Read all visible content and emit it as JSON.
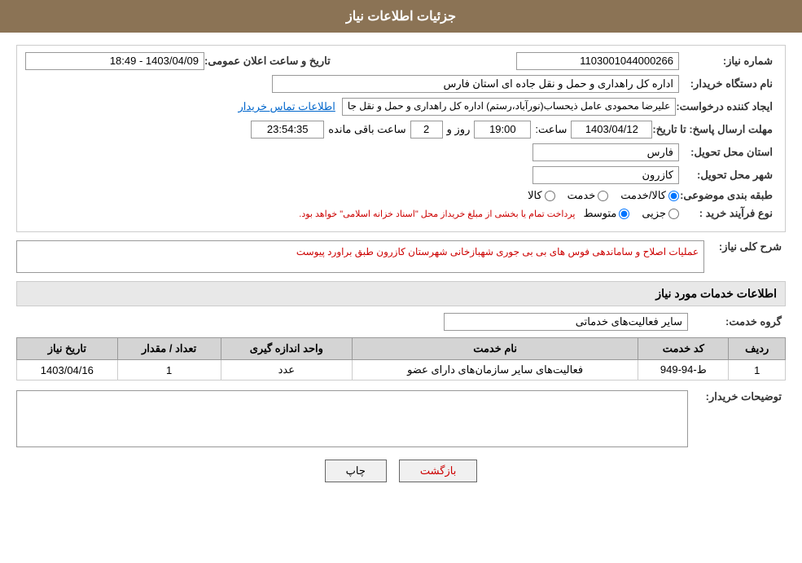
{
  "header": {
    "title": "جزئیات اطلاعات نیاز"
  },
  "fields": {
    "need_number_label": "شماره نیاز:",
    "need_number_value": "1103001044000266",
    "buyer_org_label": "نام دستگاه خریدار:",
    "buyer_org_value": "اداره کل راهداری و حمل و نقل جاده ای استان فارس",
    "creator_label": "ایجاد کننده درخواست:",
    "creator_value": "علیرضا محمودی عامل ذیحساب(نورآباد،رستم) اداره کل راهداری و حمل و نقل جا",
    "creator_link": "اطلاعات تماس خریدار",
    "response_date_label": "مهلت ارسال پاسخ: تا تاریخ:",
    "response_date": "1403/04/12",
    "response_time_label": "ساعت:",
    "response_time": "19:00",
    "response_days_label": "روز و",
    "response_days": "2",
    "remaining_time_label": "ساعت باقی مانده",
    "remaining_time": "23:54:35",
    "announce_date_label": "تاریخ و ساعت اعلان عمومی:",
    "announce_date_value": "1403/04/09 - 18:49",
    "province_label": "استان محل تحویل:",
    "province_value": "فارس",
    "city_label": "شهر محل تحویل:",
    "city_value": "کازرون",
    "category_label": "طبقه بندی موضوعی:",
    "category_kala": "کالا",
    "category_khadamat": "خدمت",
    "category_kala_khadamat": "کالا/خدمت",
    "category_selected": "kala_khadamat",
    "purchase_type_label": "نوع فرآیند خرید :",
    "purchase_jozyi": "جزیی",
    "purchase_motavaset": "متوسط",
    "purchase_note": "پرداخت تمام یا بخشی از مبلغ خریداز محل \"اسناد خزانه اسلامی\" خواهد بود.",
    "description_label": "شرح کلی نیاز:",
    "description_value": "عملیات اصلاح و ساماندهی فوس های بی بی جوری شهبازخانی شهرستان کازرون طبق براورد پیوست",
    "services_section_title": "اطلاعات خدمات مورد نیاز",
    "service_group_label": "گروه خدمت:",
    "service_group_value": "سایر فعالیت‌های خدماتی",
    "table": {
      "headers": [
        "ردیف",
        "کد خدمت",
        "نام خدمت",
        "واحد اندازه گیری",
        "تعداد / مقدار",
        "تاریخ نیاز"
      ],
      "rows": [
        {
          "row_num": "1",
          "service_code": "ط-94-949",
          "service_name": "فعالیت‌های سایر سازمان‌های دارای عضو",
          "unit": "عدد",
          "quantity": "1",
          "need_date": "1403/04/16"
        }
      ]
    },
    "buyer_notes_label": "توضیحات خریدار:",
    "buyer_notes_value": "",
    "btn_print": "چاپ",
    "btn_back": "بازگشت"
  }
}
